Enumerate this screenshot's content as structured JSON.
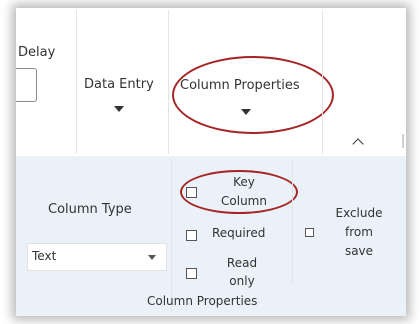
{
  "ribbon": {
    "delay_label": "Delay",
    "data_entry_label": "Data Entry",
    "column_properties_label": "Column Properties"
  },
  "panel": {
    "column_type_label": "Column Type",
    "column_type_value": "Text",
    "key_column_line1": "Key",
    "key_column_line2": "Column",
    "required_label": "Required",
    "read_only_line1": "Read",
    "read_only_line2": "only",
    "exclude_line1": "Exclude",
    "exclude_line2": "from",
    "exclude_line3": "save",
    "group_label": "Column Properties"
  },
  "colors": {
    "panel_bg": "#eaf1f8",
    "highlight_ring": "#a52525"
  }
}
